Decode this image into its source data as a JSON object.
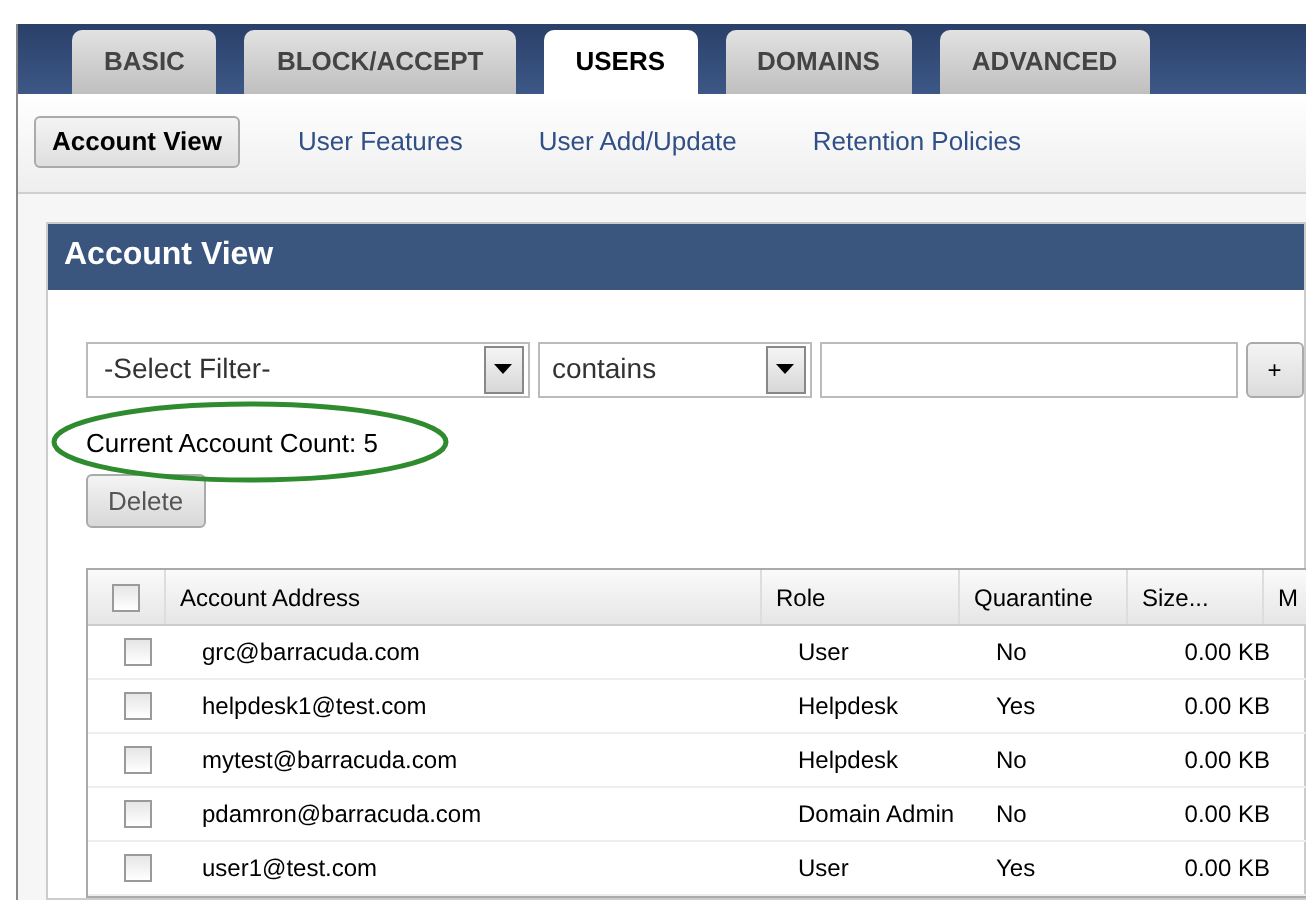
{
  "tabs": [
    {
      "label": "BASIC",
      "selected": false
    },
    {
      "label": "BLOCK/ACCEPT",
      "selected": false
    },
    {
      "label": "USERS",
      "selected": true
    },
    {
      "label": "DOMAINS",
      "selected": false
    },
    {
      "label": "ADVANCED",
      "selected": false
    }
  ],
  "subtabs": [
    {
      "label": "Account View",
      "selected": true
    },
    {
      "label": "User Features",
      "selected": false
    },
    {
      "label": "User Add/Update",
      "selected": false
    },
    {
      "label": "Retention Policies",
      "selected": false
    }
  ],
  "panel": {
    "title": "Account View",
    "filter": {
      "field": "-Select Filter-",
      "operator": "contains",
      "add_button": "+"
    },
    "account_count": "Current Account Count: 5",
    "delete_button": "Delete",
    "table": {
      "select_all_checked": false,
      "columns": [
        "Account Address",
        "Role",
        "Quarantine",
        "Size...",
        "M"
      ],
      "rows": [
        {
          "checked": false,
          "cells": [
            "grc@barracuda.com",
            "User",
            "No",
            "0.00 KB"
          ]
        },
        {
          "checked": false,
          "cells": [
            "helpdesk1@test.com",
            "Helpdesk",
            "Yes",
            "0.00 KB"
          ]
        },
        {
          "checked": false,
          "cells": [
            "mytest@barracuda.com",
            "Helpdesk",
            "No",
            "0.00 KB"
          ]
        },
        {
          "checked": false,
          "cells": [
            "pdamron@barracuda.com",
            "Domain Admin",
            "No",
            "0.00 KB"
          ]
        },
        {
          "checked": false,
          "cells": [
            "user1@test.com",
            "User",
            "Yes",
            "0.00 KB"
          ]
        }
      ]
    }
  }
}
